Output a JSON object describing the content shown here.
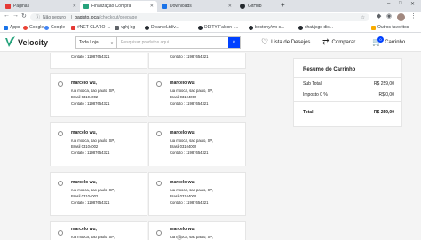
{
  "browser": {
    "tabs": [
      {
        "label": "Páginas",
        "active": false
      },
      {
        "label": "Finalização Compra",
        "active": true
      },
      {
        "label": "Downloads",
        "active": false
      },
      {
        "label": "GitHub",
        "active": false
      }
    ],
    "new_tab": "+",
    "address": {
      "security": "Não seguro",
      "host": "bagisto.local",
      "path": "/checkout/onepage"
    },
    "bookmarks": [
      "Apps",
      "Google",
      "Google",
      "#NET-CLARO-...",
      "vghj bg",
      "DivanteLtd/v...",
      "DEITY Falcon -...",
      "bestony/wx-s...",
      "xhat/jsgs-dis...",
      "Outros favoritos"
    ],
    "colors": {
      "tab_strip": "#dee1e6",
      "toolbar": "#ffffff"
    }
  },
  "header": {
    "logo": "Velocity",
    "search": {
      "category": "Toda Loja",
      "placeholder": "Pesquisar produtos aqui"
    },
    "wishlist": "Lista de Desejos",
    "compare": "Comparar",
    "cart": "Carrinho",
    "cart_count": "0",
    "colors": {
      "accent": "#0041ff",
      "logo_green": "#26a37c"
    }
  },
  "addresses": [
    {
      "name": "",
      "street": "",
      "city": "",
      "country": "",
      "contact": "Contato : 11987654321"
    },
    {
      "name": "",
      "street": "",
      "city": "",
      "country": "",
      "contact": "Contato : 11987654321"
    },
    {
      "name": "marcelo wu,",
      "street": "rua mooca, sao paulo, SP,",
      "city": "Brasil 03104002",
      "country": "",
      "contact": "Contato : 11987654321"
    },
    {
      "name": "marcelo wu,",
      "street": "rua mooca, sao paulo, SP,",
      "city": "Brasil 03104002",
      "country": "",
      "contact": "Contato : 11987654321"
    },
    {
      "name": "marcelo wu,",
      "street": "rua mooca, sao paulo, SP,",
      "city": "Brasil 03104002",
      "country": "",
      "contact": "Contato : 11987654321"
    },
    {
      "name": "marcelo wu,",
      "street": "rua mooca, sao paulo, SP,",
      "city": "Brasil 03104002",
      "country": "",
      "contact": "Contato : 11987654321"
    },
    {
      "name": "marcelo wu,",
      "street": "rua mooca, sao paulo, SP,",
      "city": "Brasil 03104002",
      "country": "",
      "contact": "Contato : 11987654321"
    },
    {
      "name": "marcelo wu,",
      "street": "rua mooca, sao paulo, SP,",
      "city": "Brasil 03104002",
      "country": "",
      "contact": "Contato : 11987654321"
    },
    {
      "name": "marcelo wu,",
      "street": "rua mooca, sao paulo, SP,",
      "city": "",
      "country": "",
      "contact": ""
    },
    {
      "name": "marcelo wu,",
      "street": "rua mooca, sao paulo, SP,",
      "city": "",
      "country": "",
      "contact": ""
    }
  ],
  "summary": {
    "title": "Resumo do Carrinho",
    "subtotal_label": "Sub Total",
    "subtotal_value": "R$ 259,00",
    "tax_label": "Imposto 0 %",
    "tax_value": "R$ 0,00",
    "total_label": "Total",
    "total_value": "R$ 259,00"
  }
}
